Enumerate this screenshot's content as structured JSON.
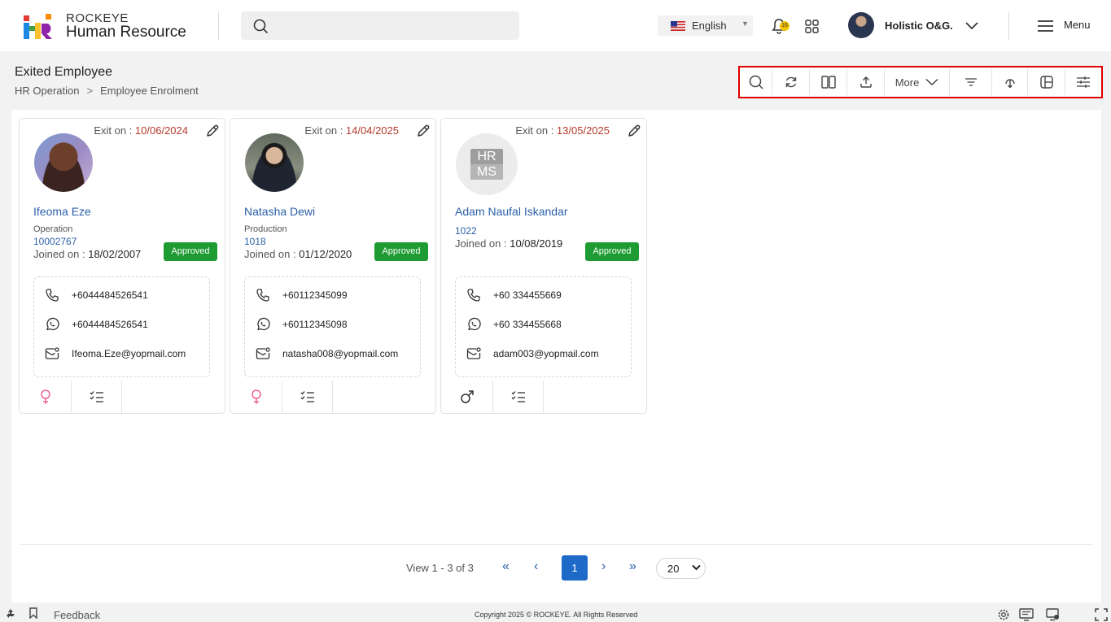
{
  "brand": {
    "top": "ROCKEYE",
    "bottom": "Human Resource"
  },
  "header": {
    "language": "English",
    "notification_count": "16",
    "user_name": "Holistic O&G.",
    "menu_label": "Menu"
  },
  "page": {
    "title": "Exited Employee",
    "breadcrumb": [
      "HR Operation",
      "Employee Enrolment"
    ]
  },
  "toolbar": {
    "more_label": "More"
  },
  "cards": [
    {
      "exit_label": "Exit on : ",
      "exit_date": "10/06/2024",
      "name": "Ifeoma Eze",
      "department": "Operation",
      "employee_id": "10002767",
      "joined_label": "Joined on : ",
      "joined_date": "18/02/2007",
      "status": "Approved",
      "phone": "+6044484526541",
      "whatsapp": "+6044484526541",
      "email": "Ifeoma.Eze@yopmail.com",
      "gender": "female"
    },
    {
      "exit_label": "Exit on : ",
      "exit_date": "14/04/2025",
      "name": "Natasha Dewi",
      "department": "Production",
      "employee_id": "1018",
      "joined_label": "Joined on : ",
      "joined_date": "01/12/2020",
      "status": "Approved",
      "phone": "+60112345099",
      "whatsapp": "+60112345098",
      "email": "natasha008@yopmail.com",
      "gender": "female"
    },
    {
      "exit_label": "Exit on : ",
      "exit_date": "13/05/2025",
      "name": "Adam Naufal Iskandar",
      "department": "",
      "employee_id": "1022",
      "joined_label": "Joined on : ",
      "joined_date": "10/08/2019",
      "status": "Approved",
      "phone": "+60 334455669",
      "whatsapp": "+60 334455668",
      "email": "adam003@yopmail.com",
      "gender": "male",
      "placeholder_top": "HR",
      "placeholder_bottom": "MS"
    }
  ],
  "pagination": {
    "view_text": "View 1 - 3 of 3",
    "current_page": "1",
    "page_size": "20"
  },
  "footer": {
    "feedback": "Feedback",
    "copyright": "Copyright 2025 © ROCKEYE. All Rights Reserved"
  },
  "colors": {
    "accent": "#1e6ac8",
    "link": "#2b5fa8",
    "approved": "#1e9c33",
    "exit_date": "#b53a2b",
    "highlight_border": "#e00000"
  }
}
